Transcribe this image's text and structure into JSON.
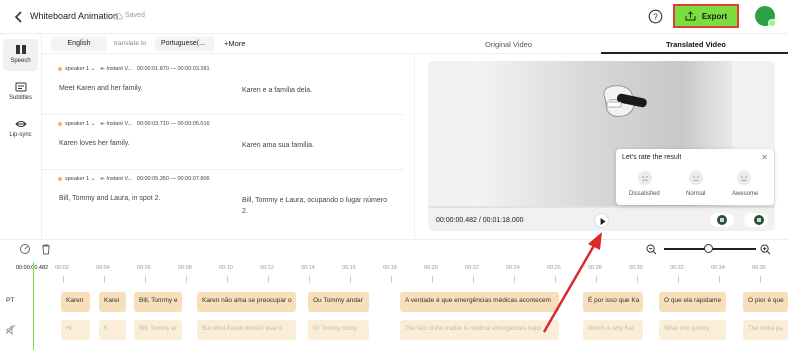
{
  "header": {
    "title": "Whiteboard Animation",
    "saved": "Saved",
    "export_label": "Export"
  },
  "sidebar": {
    "items": [
      {
        "label": "Speech"
      },
      {
        "label": "Subtitles"
      },
      {
        "label": "Lip-sync"
      }
    ]
  },
  "language": {
    "source": "English",
    "translate_to": "translate to",
    "target": "Portuguese(...",
    "more": "More"
  },
  "rows": [
    {
      "speaker": "speaker 1",
      "voice": "Instant V...",
      "start": "00:00:01.870",
      "end": "00:00:03.281",
      "source": "Meet Karen and her family.",
      "translation": "Karen e a família dela."
    },
    {
      "speaker": "speaker 1",
      "voice": "Instant V...",
      "start": "00:00:03.710",
      "end": "00:00:05.016",
      "source": "Karen loves her family.",
      "translation": "Karen ama sua família."
    },
    {
      "speaker": "speaker 1",
      "voice": "Instant V...",
      "start": "00:00:05.350",
      "end": "00:00:07.806",
      "source": "Bill, Tommy and Laura, in spot 2.",
      "translation": "Bill, Tommy e Laura, ocupando o lugar número 2."
    }
  ],
  "video": {
    "tabs": [
      "Original Video",
      "Translated Video"
    ],
    "timecode": "00:00:00.482 / 00:01:18.000"
  },
  "rating": {
    "title": "Let's rate the result",
    "options": [
      "Dissatisfied",
      "Normal",
      "Awesome"
    ]
  },
  "timeline": {
    "current": "00:00:00.482",
    "ticks": [
      "00:02",
      "00:04",
      "00:06",
      "00:08",
      "00:10",
      "00:12",
      "00:14",
      "00:16",
      "00:18",
      "00:20",
      "00:22",
      "00:24",
      "00:26",
      "00:28",
      "00:30",
      "00:32",
      "00:34",
      "00:36"
    ],
    "track_label": "PT",
    "segments": [
      "Karen",
      "Karei",
      "Bill, Tommy e",
      "Karen não ama se preocupar o",
      "Ou Tommy andar",
      "A verdade é que emergências médicas acontecem",
      "É por isso que Ka",
      "O que ela rapidame",
      "O pior é que"
    ],
    "originals": [
      "Hi",
      "K",
      "Bill, Tommy ar",
      "But what Karen doesn't love is",
      "Or Tommy riding",
      "The fact of the matter is medical emergencies happ",
      "Which is why Kar",
      "What she quickly",
      "The worst pa"
    ]
  },
  "colors": {
    "accent": "#7bde3f",
    "highlight_border": "#e23b3b",
    "segment": "#f6dfb9",
    "avatar": "#2e9f45"
  }
}
